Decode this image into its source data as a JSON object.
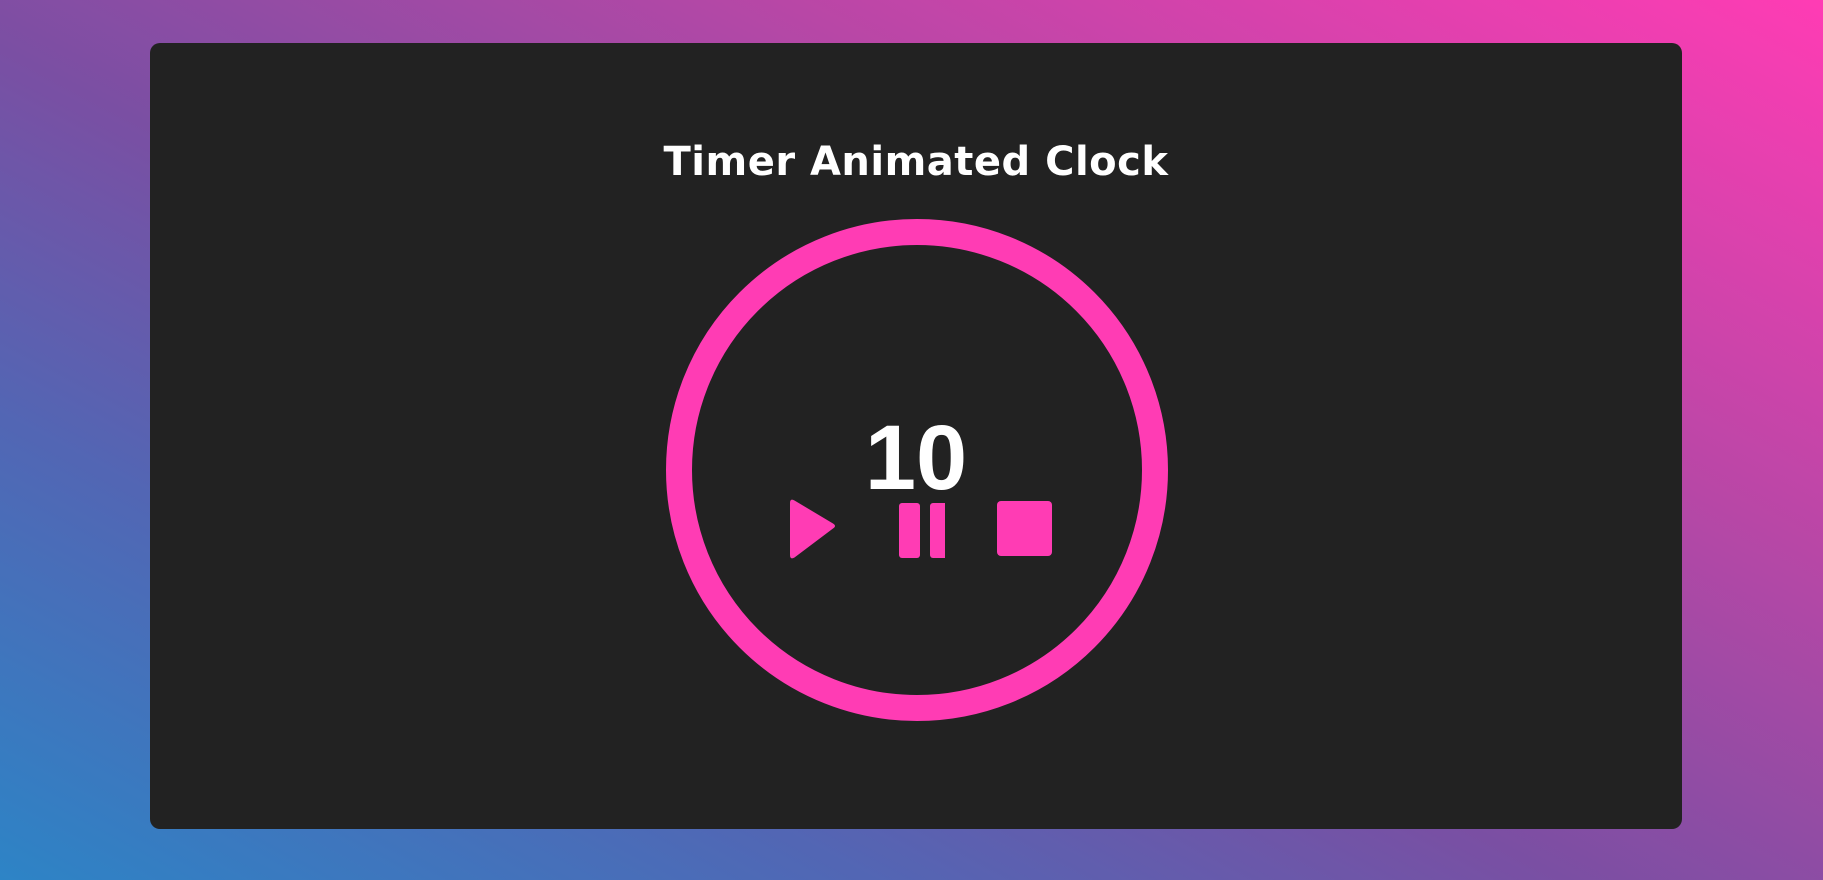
{
  "app": {
    "title": "Timer Animated Clock"
  },
  "timer": {
    "value": "10"
  },
  "controls": {
    "play": {
      "icon": "play-icon"
    },
    "pause": {
      "icon": "pause-icon"
    },
    "stop": {
      "icon": "stop-icon"
    }
  },
  "colors": {
    "accent": "#ff3cb4",
    "card_background": "#222222",
    "text": "#ffffff",
    "gradient_top_right": "#ff3cb4",
    "gradient_bottom_left": "#2d84c6"
  }
}
